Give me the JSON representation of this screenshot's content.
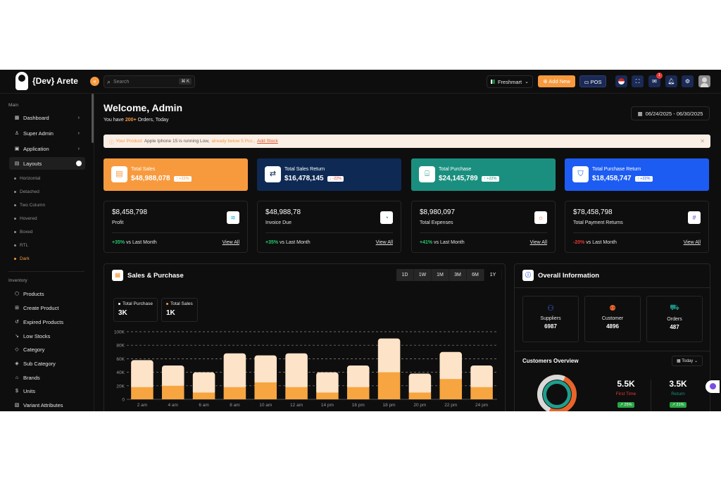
{
  "brand": {
    "name": "{Dev} Arete"
  },
  "header": {
    "collapse_glyph": "«",
    "search_placeholder": "Search",
    "search_shortcut": "⌘ K",
    "store": "Freshmart",
    "add_new": "Add New",
    "pos": "POS",
    "mail_badge": "1"
  },
  "sidebar": {
    "main_label": "Main",
    "items": [
      "Dashboard",
      "Super Admin",
      "Application",
      "Layouts"
    ],
    "layouts": [
      "Horizontal",
      "Detached",
      "Two Column",
      "Hovered",
      "Boxed",
      "RTL",
      "Dark"
    ],
    "inventory_label": "Inventory",
    "inventory": [
      "Products",
      "Create Product",
      "Expired Products",
      "Low Stocks",
      "Category",
      "Sub Category",
      "Brands",
      "Units",
      "Variant Attributes"
    ]
  },
  "welcome": {
    "title": "Welcome, Admin",
    "sub_pre": "You have ",
    "sub_count": "200+",
    "sub_post": " Orders, Today",
    "date_range": "06/24/2025 - 06/30/2025"
  },
  "alert": {
    "pre": "Your Product ",
    "product": "Apple Iphone 15 is running Low,",
    "post": " already below 5 Pcs.,",
    "link": "Add Stock"
  },
  "stats": [
    {
      "label": "Total Sales",
      "value": "$48,988,078",
      "change": "↑ +22%",
      "bg": "#f79a3e",
      "change_color": "#f79a3e",
      "icon": "file-icon"
    },
    {
      "label": "Total Sales Return",
      "value": "$16,478,145",
      "change": "↓ -22%",
      "bg": "#0e2a54",
      "change_color": "#e53935",
      "icon": "swap-icon"
    },
    {
      "label": "Total Purchase",
      "value": "$24,145,789",
      "change": "↑ +22%",
      "bg": "#1b8f7f",
      "change_color": "#1b8f7f",
      "icon": "gift-icon"
    },
    {
      "label": "Total Purchase Return",
      "value": "$18,458,747",
      "change": "↑ +22%",
      "bg": "#1d5cf2",
      "change_color": "#1d5cf2",
      "icon": "shield-icon"
    }
  ],
  "cards": [
    {
      "value": "$8,458,798",
      "label": "Profit",
      "pct": "+35%",
      "pct_color": "#28c76f",
      "suffix": " vs Last Month",
      "link": "View All",
      "icon_color": "#1fb6e0"
    },
    {
      "value": "$48,988,78",
      "label": "Invoice Due",
      "pct": "+35%",
      "pct_color": "#28c76f",
      "suffix": " vs Last Month",
      "link": "View All",
      "icon_color": "#1b8f7f"
    },
    {
      "value": "$8,980,097",
      "label": "Total Expenses",
      "pct": "+41%",
      "pct_color": "#28c76f",
      "suffix": " vs Last Month",
      "link": "View All",
      "icon_color": "#e8642a"
    },
    {
      "value": "$78,458,798",
      "label": "Total Payment Returns",
      "pct": "-20%",
      "pct_color": "#e53935",
      "suffix": " vs Last Month",
      "link": "View All",
      "icon_color": "#5b47d8"
    }
  ],
  "sales_panel": {
    "title": "Sales & Purchase",
    "ranges": [
      "1D",
      "1W",
      "1M",
      "3M",
      "6M",
      "1Y"
    ],
    "active_range": "1Y",
    "legend": [
      {
        "label": "Total Purchase",
        "value": "3K",
        "color": "#ffffff"
      },
      {
        "label": "Total Sales",
        "value": "1K",
        "color": "#f79a3e"
      }
    ]
  },
  "chart_data": {
    "type": "bar",
    "stacked": true,
    "categories": [
      "2 am",
      "4 am",
      "6 am",
      "8 am",
      "10 am",
      "12 am",
      "14 pm",
      "16 pm",
      "18 pm",
      "20 pm",
      "22 pm",
      "24 pm"
    ],
    "series": [
      {
        "name": "Total Sales",
        "values": [
          18,
          20,
          10,
          18,
          25,
          18,
          10,
          18,
          40,
          10,
          30,
          18
        ],
        "color": "#f7a540"
      },
      {
        "name": "Total Purchase",
        "values": [
          40,
          30,
          30,
          50,
          40,
          50,
          30,
          32,
          50,
          28,
          40,
          32
        ],
        "color": "#fde3c8"
      }
    ],
    "yticks": [
      "0",
      "20K",
      "40K",
      "60K",
      "80K",
      "100K"
    ],
    "ylim": [
      0,
      100
    ],
    "grid": true
  },
  "overall": {
    "title": "Overall Information",
    "items": [
      {
        "label": "Suppliers",
        "value": "6987",
        "color": "#3b6be0",
        "icon": "users-icon"
      },
      {
        "label": "Customer",
        "value": "4896",
        "color": "#e8642a",
        "icon": "customers-icon"
      },
      {
        "label": "Orders",
        "value": "487",
        "color": "#1b8f7f",
        "icon": "cart-icon"
      }
    ],
    "customers_title": "Customers Overview",
    "period": "Today",
    "first_value": "5.5K",
    "first_label": "First Time",
    "first_pct": "↗ 25%",
    "return_value": "3.5K",
    "return_label": "Return",
    "return_pct": "↗ 21%",
    "first_color": "#e53935",
    "return_color": "#1b8f7f"
  }
}
